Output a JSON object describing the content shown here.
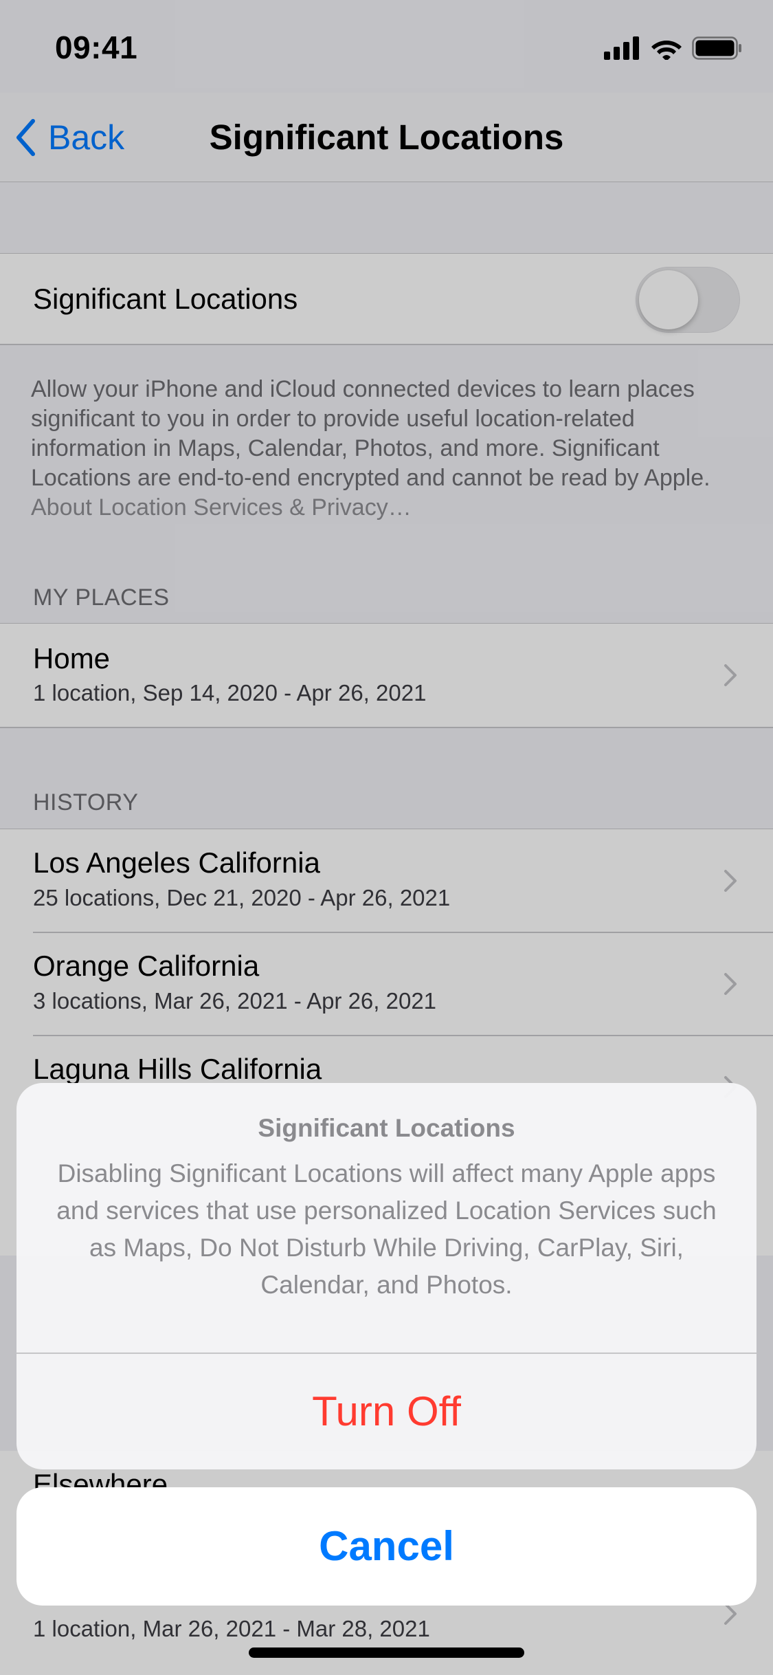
{
  "status_bar": {
    "time": "09:41",
    "icons": [
      "signal-icon",
      "wifi-icon",
      "battery-icon"
    ]
  },
  "nav": {
    "back_label": "Back",
    "title": "Significant Locations"
  },
  "toggle_row": {
    "label": "Significant Locations",
    "state": "off"
  },
  "description": {
    "text": "Allow your iPhone and iCloud connected devices to learn places significant to you in order to provide useful location-related information in Maps, Calendar, Photos, and more. Significant Locations are end-to-end encrypted and cannot be read by Apple.",
    "link": "About Location Services & Privacy…"
  },
  "my_places": {
    "header": "MY PLACES",
    "items": [
      {
        "title": "Home",
        "subtitle": "1 location, Sep 14, 2020 - Apr 26, 2021"
      }
    ]
  },
  "history": {
    "header": "HISTORY",
    "items": [
      {
        "title": "Los Angeles California",
        "subtitle": "25 locations, Dec 21, 2020 - Apr 26, 2021"
      },
      {
        "title": "Orange California",
        "subtitle": "3 locations, Mar 26, 2021 - Apr 26, 2021"
      },
      {
        "title": "Laguna Hills California",
        "subtitle": ""
      },
      {
        "title": "Elsewhere",
        "subtitle": "1 location, Mar 26, 2021 - Mar 28, 2021"
      }
    ]
  },
  "action_sheet": {
    "title": "Significant Locations",
    "message": "Disabling Significant Locations will affect many Apple apps and services that use personalized Location Services such as Maps, Do Not Disturb While Driving, CarPlay, Siri, Calendar, and Photos.",
    "destructive_label": "Turn Off",
    "cancel_label": "Cancel"
  },
  "colors": {
    "accent": "#007aff",
    "destructive": "#ff3b30",
    "grouped_bg": "#f2f2f7"
  }
}
